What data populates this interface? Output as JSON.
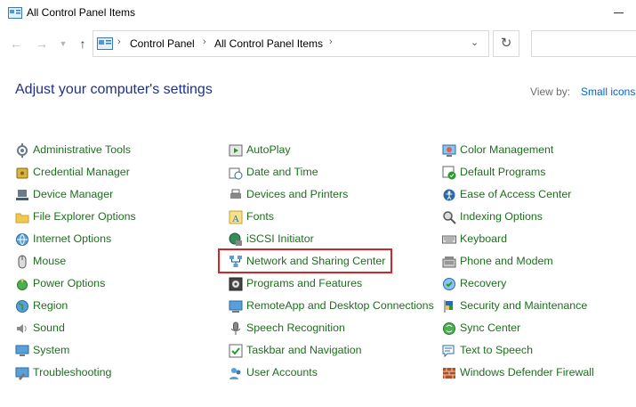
{
  "window": {
    "title": "All Control Panel Items"
  },
  "address": {
    "crumbs": [
      "Control Panel",
      "All Control Panel Items"
    ]
  },
  "header": {
    "title": "Adjust your computer's settings",
    "view_by_label": "View by:",
    "view_by_value": "Small icons"
  },
  "columns": [
    [
      {
        "label": "Administrative Tools",
        "icon": "administrative-tools-icon"
      },
      {
        "label": "Credential Manager",
        "icon": "credential-manager-icon"
      },
      {
        "label": "Device Manager",
        "icon": "device-manager-icon"
      },
      {
        "label": "File Explorer Options",
        "icon": "folder-options-icon"
      },
      {
        "label": "Internet Options",
        "icon": "internet-options-icon"
      },
      {
        "label": "Mouse",
        "icon": "mouse-icon"
      },
      {
        "label": "Power Options",
        "icon": "power-options-icon"
      },
      {
        "label": "Region",
        "icon": "region-icon"
      },
      {
        "label": "Sound",
        "icon": "sound-icon"
      },
      {
        "label": "System",
        "icon": "system-icon"
      },
      {
        "label": "Troubleshooting",
        "icon": "troubleshooting-icon"
      }
    ],
    [
      {
        "label": "AutoPlay",
        "icon": "autoplay-icon"
      },
      {
        "label": "Date and Time",
        "icon": "date-time-icon"
      },
      {
        "label": "Devices and Printers",
        "icon": "devices-printers-icon"
      },
      {
        "label": "Fonts",
        "icon": "fonts-icon"
      },
      {
        "label": "iSCSI Initiator",
        "icon": "iscsi-icon"
      },
      {
        "label": "Network and Sharing Center",
        "icon": "network-sharing-icon"
      },
      {
        "label": "Programs and Features",
        "icon": "programs-features-icon"
      },
      {
        "label": "RemoteApp and Desktop Connections",
        "icon": "remoteapp-icon"
      },
      {
        "label": "Speech Recognition",
        "icon": "microphone-icon"
      },
      {
        "label": "Taskbar and Navigation",
        "icon": "taskbar-icon"
      },
      {
        "label": "User Accounts",
        "icon": "user-accounts-icon"
      }
    ],
    [
      {
        "label": "Color Management",
        "icon": "color-management-icon"
      },
      {
        "label": "Default Programs",
        "icon": "default-programs-icon"
      },
      {
        "label": "Ease of Access Center",
        "icon": "ease-of-access-icon"
      },
      {
        "label": "Indexing Options",
        "icon": "indexing-options-icon"
      },
      {
        "label": "Keyboard",
        "icon": "keyboard-icon"
      },
      {
        "label": "Phone and Modem",
        "icon": "phone-modem-icon"
      },
      {
        "label": "Recovery",
        "icon": "recovery-icon"
      },
      {
        "label": "Security and Maintenance",
        "icon": "security-flag-icon"
      },
      {
        "label": "Sync Center",
        "icon": "sync-center-icon"
      },
      {
        "label": "Text to Speech",
        "icon": "text-to-speech-icon"
      },
      {
        "label": "Windows Defender Firewall",
        "icon": "firewall-icon"
      }
    ]
  ],
  "colors": {
    "heading": "#1e3287",
    "link": "#1e6e1e",
    "highlight": "#d0262a"
  }
}
